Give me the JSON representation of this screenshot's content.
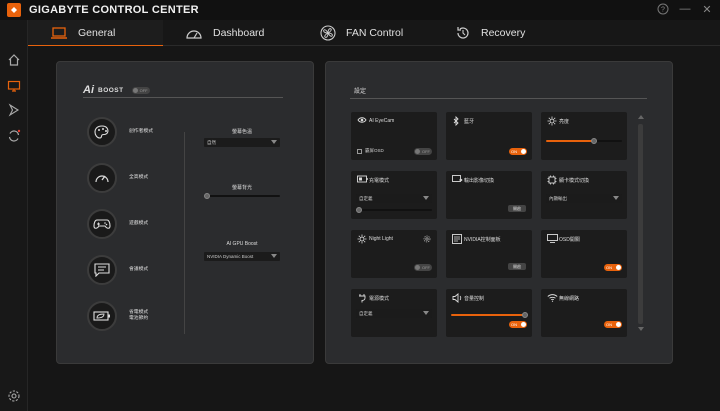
{
  "app": {
    "title": "GIGABYTE CONTROL CENTER"
  },
  "window_controls": {
    "help": "?",
    "minimize": "—",
    "close": "✕"
  },
  "tabs": [
    {
      "label": "General",
      "icon": "laptop-icon",
      "active": true
    },
    {
      "label": "Dashboard",
      "icon": "gauge-icon",
      "active": false
    },
    {
      "label": "FAN Control",
      "icon": "fan-icon",
      "active": false
    },
    {
      "label": "Recovery",
      "icon": "recovery-icon",
      "active": false
    }
  ],
  "sidebar": [
    "home-icon",
    "display-icon",
    "arrow-icon",
    "sync-icon",
    "settings-icon"
  ],
  "aiboost": {
    "logo": "Ai",
    "title": "BOOST",
    "toggle_label": "OFF",
    "modes": [
      {
        "label": "創作者模式",
        "icon": "palette-icon"
      },
      {
        "label": "全高模式",
        "icon": "speedometer-icon"
      },
      {
        "label": "遊戲模式",
        "icon": "gamepad-icon"
      },
      {
        "label": "會議模式",
        "icon": "chat-icon"
      },
      {
        "label": "省電模式\n電池節約",
        "icon": "battery-leaf-icon"
      }
    ],
    "color_label": "螢幕色溫",
    "color_value": "自然",
    "brightness_label": "螢幕背光",
    "gpu_label": "AI GPU Boost",
    "gpu_value": "NVIDIA Dynamic Boost"
  },
  "settings": {
    "title": "設定",
    "cards": {
      "eyecam": {
        "title": "AI EyeCam",
        "checkbox": "霸屏OSD",
        "toggle": "OFF"
      },
      "bluetooth": {
        "title": "藍牙",
        "toggle": "ON"
      },
      "brightness": {
        "title": "亮度",
        "level": 0.63
      },
      "power": {
        "title": "充電模式",
        "value": "自定義",
        "level": 0
      },
      "display_switch": {
        "title": "輸出影像切換",
        "button": "開啟"
      },
      "gpu_switch": {
        "title": "顯卡模式切換",
        "value": "內顯輸出"
      },
      "nightlight": {
        "title": "Night Light",
        "toggle": "OFF"
      },
      "nvidia": {
        "title": "NVIDIA控制面板",
        "button": "開啟"
      },
      "osd": {
        "title": "OSD開關",
        "toggle": "ON"
      },
      "power_mode": {
        "title": "電源模式",
        "value": "自定義"
      },
      "volume": {
        "title": "音量控制",
        "level": 0.97,
        "toggle": "ON"
      },
      "wifi": {
        "title": "無線網路",
        "toggle": "ON"
      }
    }
  },
  "colors": {
    "accent": "#e8620c",
    "panel": "#2b2c2e",
    "card": "#1c1c1c"
  }
}
